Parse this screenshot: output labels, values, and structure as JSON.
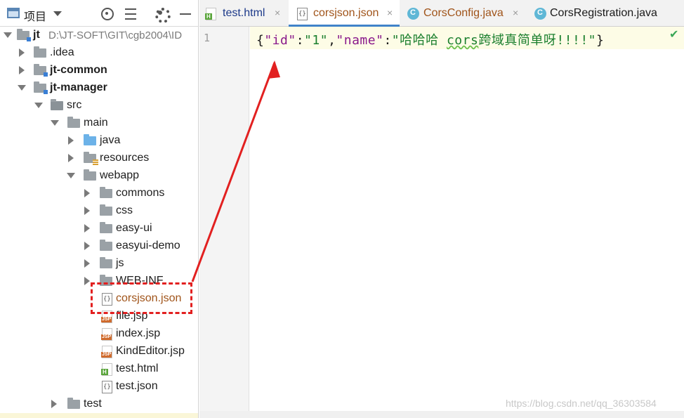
{
  "project_panel": {
    "title": "项目",
    "tree": [
      {
        "label": "jt",
        "path": "D:\\JT-SOFT\\GIT\\cgb2004\\ID",
        "kind": "module",
        "expanded": true,
        "bold": true
      },
      {
        "label": ".idea",
        "kind": "folder",
        "expanded": false
      },
      {
        "label": "jt-common",
        "kind": "module",
        "expanded": false,
        "bold": true
      },
      {
        "label": "jt-manager",
        "kind": "module",
        "expanded": true,
        "bold": true
      },
      {
        "label": "src",
        "kind": "folder",
        "expanded": true
      },
      {
        "label": "main",
        "kind": "folder",
        "expanded": true
      },
      {
        "label": "java",
        "kind": "source-folder",
        "expanded": false
      },
      {
        "label": "resources",
        "kind": "resource-folder",
        "expanded": false
      },
      {
        "label": "webapp",
        "kind": "folder",
        "expanded": true
      },
      {
        "label": "commons",
        "kind": "folder",
        "expanded": false
      },
      {
        "label": "css",
        "kind": "folder",
        "expanded": false
      },
      {
        "label": "easy-ui",
        "kind": "folder",
        "expanded": false
      },
      {
        "label": "easyui-demo",
        "kind": "folder",
        "expanded": false
      },
      {
        "label": "js",
        "kind": "folder",
        "expanded": false
      },
      {
        "label": "WEB-INF",
        "kind": "folder",
        "expanded": false
      },
      {
        "label": "corsjson.json",
        "kind": "json-file",
        "modified": true,
        "highlighted": true
      },
      {
        "label": "file.jsp",
        "kind": "jsp-file"
      },
      {
        "label": "index.jsp",
        "kind": "jsp-file"
      },
      {
        "label": "KindEditor.jsp",
        "kind": "jsp-file"
      },
      {
        "label": "test.html",
        "kind": "html-file"
      },
      {
        "label": "test.json",
        "kind": "json-file"
      },
      {
        "label": "test",
        "kind": "folder",
        "expanded": false
      }
    ]
  },
  "editor": {
    "tabs": [
      {
        "label": "test.html",
        "icon": "html-file-icon",
        "active": false,
        "color": "#1d3a8a"
      },
      {
        "label": "corsjson.json",
        "icon": "json-file-icon",
        "active": true,
        "color": "#a0541a"
      },
      {
        "label": "CorsConfig.java",
        "icon": "class-icon",
        "active": false,
        "color": "#a0541a"
      },
      {
        "label": "CorsRegistration.java",
        "icon": "class-icon",
        "active": false,
        "color": "#1a1a1a"
      }
    ],
    "close_glyph": "×",
    "line_number": "1",
    "code": {
      "open_brace": "{",
      "key_id": "\"id\"",
      "colon1": ":",
      "val_id": "\"1\"",
      "comma": ",",
      "key_name": "\"name\"",
      "colon2": ":",
      "val_name_prefix": "\"哈哈哈 ",
      "val_name_underlined": "cors",
      "val_name_suffix": "跨域真简单呀!!!!\"",
      "close_brace": "}"
    },
    "status_check": "✔"
  },
  "annotation": {
    "arrow_color": "#e22020",
    "box_color": "#e22020"
  },
  "watermark": "https://blog.csdn.net/qq_36303584"
}
